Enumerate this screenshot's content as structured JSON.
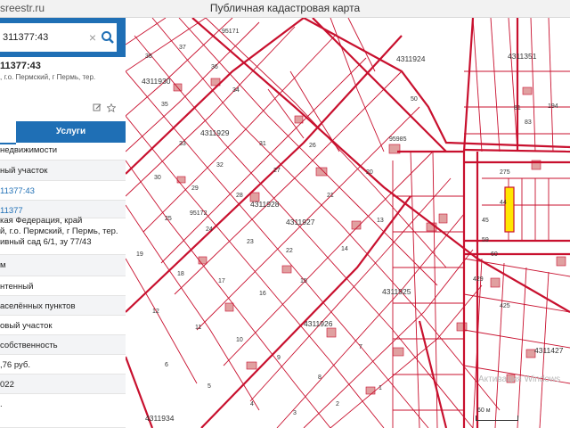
{
  "window": {
    "url_fragment": "sreestr.ru",
    "title": "Публичная кадастровая карта"
  },
  "search": {
    "value": "311377:43"
  },
  "parcel": {
    "number": "11377:43",
    "address": ", г.о. Пермский, г Пермь, тер."
  },
  "tabs": {
    "services": "Услуги"
  },
  "info_rows": [
    "недвижимости",
    "ный участок",
    "11377:43",
    "11377",
    "кая Федерация, край",
    "й, г.о. Пермский, г Пермь, тер.",
    "ивный сад 6/1, зу 77/43",
    "м",
    "нтенный",
    "аселённых пунктов",
    "овый участок",
    "собственность",
    ",76 руб.",
    "022",
    "."
  ],
  "map": {
    "quarter_labels": [
      "4311930",
      "4311929",
      "4311928",
      "4311927",
      "4311926",
      "4311925",
      "4311924",
      "4311351",
      "4311427",
      "4311934"
    ],
    "street_labels": [
      "95171",
      "95172",
      "95985"
    ],
    "plot_numbers": [
      "38",
      "37",
      "36",
      "35",
      "34",
      "33",
      "32",
      "31",
      "30",
      "29",
      "28",
      "27",
      "26",
      "25",
      "24",
      "23",
      "22",
      "21",
      "20",
      "19",
      "18",
      "17",
      "16",
      "15",
      "14",
      "13",
      "12",
      "11",
      "10",
      "9",
      "8",
      "7",
      "6",
      "5",
      "4",
      "3",
      "2",
      "1",
      "44",
      "45",
      "50",
      "59",
      "60",
      "81",
      "83",
      "194",
      "275",
      "425",
      "429"
    ],
    "scale": "60 м",
    "watermark": "Активация Windows",
    "colors": {
      "boundary": "#c8102e",
      "building": "#dd8a8a",
      "highlight": "#ffe600",
      "accent": "#1f6fb5"
    }
  }
}
